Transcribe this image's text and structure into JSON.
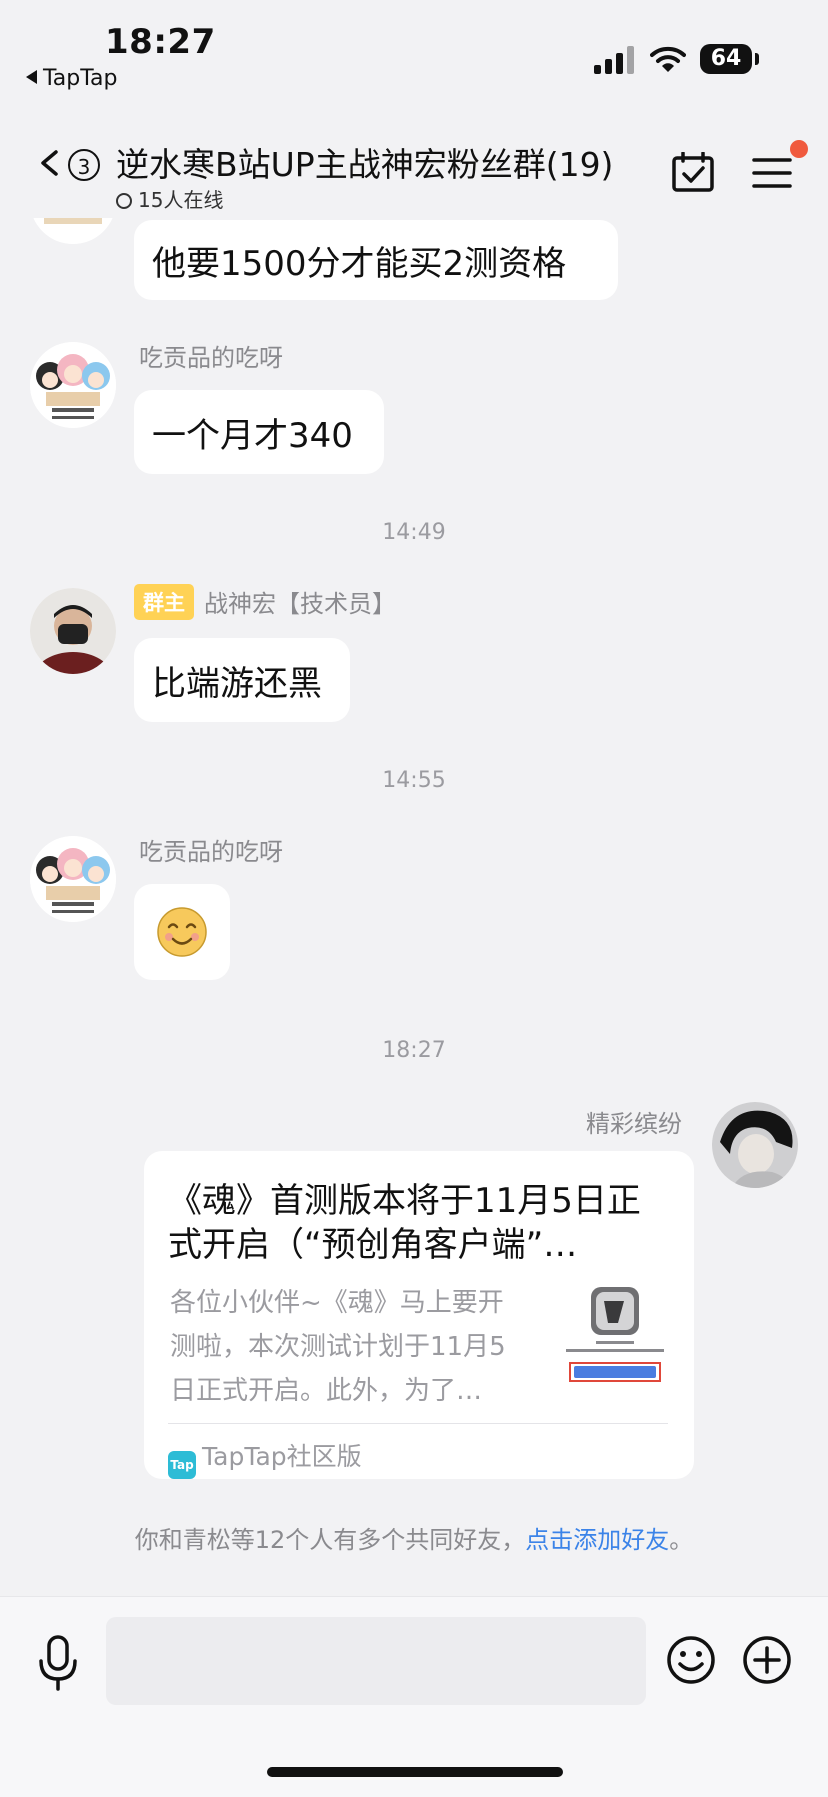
{
  "status_bar": {
    "time": "18:27",
    "back_app": "TapTap",
    "battery": "64"
  },
  "header": {
    "back_badge": "3",
    "title": "逆水寒B站UP主战神宏粉丝群(19)",
    "online": "15人在线",
    "icons": [
      "calendar-check-icon",
      "menu-icon"
    ],
    "notification_color": "#f05a3e"
  },
  "messages": {
    "m1": {
      "text": "他要1500分才能买2测资格"
    },
    "m2": {
      "sender": "吃贡品的吃呀",
      "text": "一个月才340"
    },
    "t1": "14:49",
    "m3": {
      "owner_tag": "群主",
      "sender": "战神宏【技术员】",
      "text": "比端游还黑"
    },
    "t2": "14:55",
    "m4": {
      "sender": "吃贡品的吃呀",
      "emoji": "smile-emoji-icon"
    },
    "t3": "18:27",
    "m5": {
      "sender": "精彩缤纷",
      "card_title": "《魂》首测版本将于11月5日正\n式开启（“预创角客户端”…",
      "card_desc": "各位小伙伴~《魂》马上要开\n测啦，本次测试计划于11月5\n日正式开启。此外，为了…",
      "card_source": "TapTap社区版"
    }
  },
  "notice": {
    "text": "你和青松等12个人有多个共同好友，",
    "link": "点击添加好友",
    "end": "。"
  },
  "colors": {
    "link": "#3b83e8",
    "owner_tag": "#ffd255",
    "background": "#f2f2f4"
  }
}
